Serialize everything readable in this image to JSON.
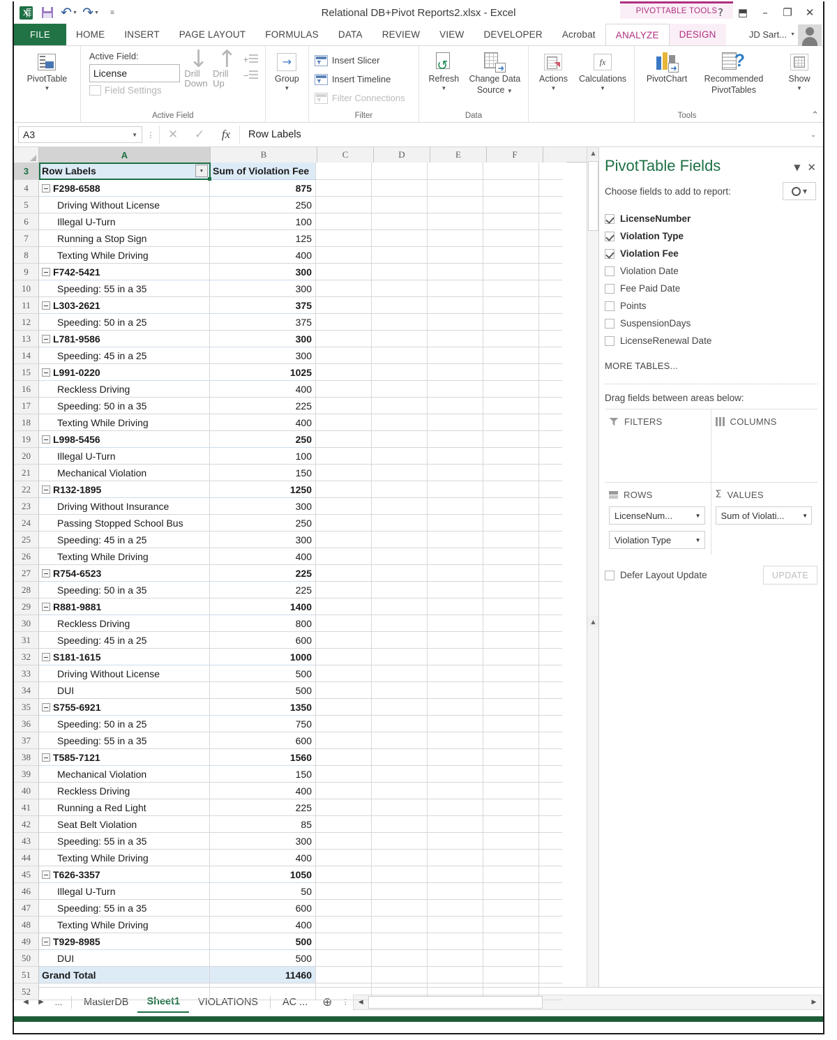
{
  "titlebar": {
    "document_title": "Relational DB+Pivot Reports2.xlsx - Excel",
    "contextual_tools_label": "PIVOTTABLE TOOLS",
    "quick_access": [
      "excel-logo",
      "save-icon",
      "undo-icon",
      "redo-icon",
      "customize-icon"
    ],
    "help_glyph": "?",
    "ribbon_display_glyph": "⬒",
    "minimize_glyph": "–",
    "restore_glyph": "❐",
    "close_glyph": "✕"
  },
  "ribbon_tabs": {
    "file": "FILE",
    "standard": [
      "HOME",
      "INSERT",
      "PAGE LAYOUT",
      "FORMULAS",
      "DATA",
      "REVIEW",
      "VIEW",
      "DEVELOPER",
      "Acrobat"
    ],
    "contextual": [
      "ANALYZE",
      "DESIGN"
    ],
    "active": "ANALYZE",
    "user": "JD Sart..."
  },
  "ribbon": {
    "groups": [
      {
        "label": "",
        "pivottable_button": "PivotTable"
      },
      {
        "label": "Active Field",
        "active_field_label": "Active Field:",
        "active_field_value": "License",
        "field_settings": "Field Settings",
        "drill_down": "Drill Down",
        "drill_up": "Drill Up",
        "expand_field": "+",
        "collapse_field": "−"
      },
      {
        "label": "",
        "group_button": "Group"
      },
      {
        "label": "Filter",
        "items": [
          "Insert Slicer",
          "Insert Timeline",
          "Filter Connections"
        ]
      },
      {
        "label": "Data",
        "refresh": "Refresh",
        "change_data_source_line1": "Change Data",
        "change_data_source_line2": "Source"
      },
      {
        "label": "",
        "actions": "Actions",
        "calculations": "Calculations"
      },
      {
        "label": "Tools",
        "pivotchart": "PivotChart",
        "recommended_line1": "Recommended",
        "recommended_line2": "PivotTables",
        "show": "Show"
      }
    ],
    "collapse_glyph": "⌃"
  },
  "formula_bar": {
    "name_box": "A3",
    "cancel_glyph": "✕",
    "enter_glyph": "✓",
    "fx_glyph": "fx",
    "content": "Row Labels",
    "expand_glyph": "⌄"
  },
  "grid": {
    "column_headers": [
      "A",
      "B",
      "C",
      "D",
      "E",
      "F"
    ],
    "selected_column": "A",
    "selected_row": "3",
    "header_row": {
      "num": "3",
      "label_a": "Row Labels",
      "label_b": "Sum of Violation Fee",
      "filter_glyph": "▼"
    },
    "rows": [
      {
        "num": "4",
        "type": "group",
        "label": "F298-6588",
        "value": "875"
      },
      {
        "num": "5",
        "type": "item",
        "label": "Driving Without License",
        "value": "250"
      },
      {
        "num": "6",
        "type": "item",
        "label": "Illegal U-Turn",
        "value": "100"
      },
      {
        "num": "7",
        "type": "item",
        "label": "Running a Stop Sign",
        "value": "125"
      },
      {
        "num": "8",
        "type": "item",
        "label": "Texting While Driving",
        "value": "400"
      },
      {
        "num": "9",
        "type": "group",
        "label": "F742-5421",
        "value": "300"
      },
      {
        "num": "10",
        "type": "item",
        "label": "Speeding: 55 in a 35",
        "value": "300"
      },
      {
        "num": "11",
        "type": "group",
        "label": "L303-2621",
        "value": "375"
      },
      {
        "num": "12",
        "type": "item",
        "label": "Speeding: 50 in a 25",
        "value": "375"
      },
      {
        "num": "13",
        "type": "group",
        "label": "L781-9586",
        "value": "300"
      },
      {
        "num": "14",
        "type": "item",
        "label": "Speeding: 45 in a 25",
        "value": "300"
      },
      {
        "num": "15",
        "type": "group",
        "label": "L991-0220",
        "value": "1025"
      },
      {
        "num": "16",
        "type": "item",
        "label": "Reckless Driving",
        "value": "400"
      },
      {
        "num": "17",
        "type": "item",
        "label": "Speeding: 50 in a 35",
        "value": "225"
      },
      {
        "num": "18",
        "type": "item",
        "label": "Texting While Driving",
        "value": "400"
      },
      {
        "num": "19",
        "type": "group",
        "label": "L998-5456",
        "value": "250"
      },
      {
        "num": "20",
        "type": "item",
        "label": "Illegal U-Turn",
        "value": "100"
      },
      {
        "num": "21",
        "type": "item",
        "label": "Mechanical Violation",
        "value": "150"
      },
      {
        "num": "22",
        "type": "group",
        "label": "R132-1895",
        "value": "1250"
      },
      {
        "num": "23",
        "type": "item",
        "label": "Driving Without Insurance",
        "value": "300"
      },
      {
        "num": "24",
        "type": "item",
        "label": "Passing Stopped School Bus",
        "value": "250"
      },
      {
        "num": "25",
        "type": "item",
        "label": "Speeding: 45 in a 25",
        "value": "300"
      },
      {
        "num": "26",
        "type": "item",
        "label": "Texting While Driving",
        "value": "400"
      },
      {
        "num": "27",
        "type": "group",
        "label": "R754-6523",
        "value": "225"
      },
      {
        "num": "28",
        "type": "item",
        "label": "Speeding: 50 in a 35",
        "value": "225"
      },
      {
        "num": "29",
        "type": "group",
        "label": "R881-9881",
        "value": "1400"
      },
      {
        "num": "30",
        "type": "item",
        "label": "Reckless Driving",
        "value": "800"
      },
      {
        "num": "31",
        "type": "item",
        "label": "Speeding: 45 in a 25",
        "value": "600"
      },
      {
        "num": "32",
        "type": "group",
        "label": "S181-1615",
        "value": "1000"
      },
      {
        "num": "33",
        "type": "item",
        "label": "Driving Without License",
        "value": "500"
      },
      {
        "num": "34",
        "type": "item",
        "label": "DUI",
        "value": "500"
      },
      {
        "num": "35",
        "type": "group",
        "label": "S755-6921",
        "value": "1350"
      },
      {
        "num": "36",
        "type": "item",
        "label": "Speeding: 50 in a 25",
        "value": "750"
      },
      {
        "num": "37",
        "type": "item",
        "label": "Speeding: 55 in a 35",
        "value": "600"
      },
      {
        "num": "38",
        "type": "group",
        "label": "T585-7121",
        "value": "1560"
      },
      {
        "num": "39",
        "type": "item",
        "label": "Mechanical Violation",
        "value": "150"
      },
      {
        "num": "40",
        "type": "item",
        "label": "Reckless Driving",
        "value": "400"
      },
      {
        "num": "41",
        "type": "item",
        "label": "Running a Red Light",
        "value": "225"
      },
      {
        "num": "42",
        "type": "item",
        "label": "Seat Belt Violation",
        "value": "85"
      },
      {
        "num": "43",
        "type": "item",
        "label": "Speeding: 55 in a 35",
        "value": "300"
      },
      {
        "num": "44",
        "type": "item",
        "label": "Texting While Driving",
        "value": "400"
      },
      {
        "num": "45",
        "type": "group",
        "label": "T626-3357",
        "value": "1050"
      },
      {
        "num": "46",
        "type": "item",
        "label": "Illegal U-Turn",
        "value": "50"
      },
      {
        "num": "47",
        "type": "item",
        "label": "Speeding: 55 in a 35",
        "value": "600"
      },
      {
        "num": "48",
        "type": "item",
        "label": "Texting While Driving",
        "value": "400"
      },
      {
        "num": "49",
        "type": "group",
        "label": "T929-8985",
        "value": "500"
      },
      {
        "num": "50",
        "type": "item",
        "label": "DUI",
        "value": "500"
      },
      {
        "num": "51",
        "type": "total",
        "label": "Grand Total",
        "value": "11460"
      },
      {
        "num": "52",
        "type": "empty",
        "label": "",
        "value": ""
      }
    ],
    "collapse_glyph": "−"
  },
  "pane": {
    "title": "PivotTable Fields",
    "collapse_glyph": "▼",
    "close_glyph": "✕",
    "choose_label": "Choose fields to add to report:",
    "gear_caret": "▾",
    "fields": [
      {
        "label": "LicenseNumber",
        "checked": true
      },
      {
        "label": "Violation Type",
        "checked": true
      },
      {
        "label": "Violation Fee",
        "checked": true
      },
      {
        "label": "Violation Date",
        "checked": false
      },
      {
        "label": "Fee Paid Date",
        "checked": false
      },
      {
        "label": "Points",
        "checked": false
      },
      {
        "label": "SuspensionDays",
        "checked": false
      },
      {
        "label": "LicenseRenewal Date",
        "checked": false
      }
    ],
    "more_tables": "MORE TABLES...",
    "drag_label": "Drag fields between areas below:",
    "areas": {
      "filters": {
        "title": "FILTERS",
        "chips": []
      },
      "columns": {
        "title": "COLUMNS",
        "chips": []
      },
      "rows": {
        "title": "ROWS",
        "chips": [
          "LicenseNum...",
          "Violation Type"
        ]
      },
      "values": {
        "title": "VALUES",
        "chips": [
          "Sum of Violati..."
        ]
      }
    },
    "defer_label": "Defer Layout Update",
    "update_button": "UPDATE"
  },
  "sheet_tabs": {
    "first_glyph": "◀",
    "last_glyph": "▶",
    "overflow_glyph": "...",
    "tabs": [
      "MasterDB",
      "Sheet1",
      "VIOLATIONS",
      "AC ..."
    ],
    "active": "Sheet1",
    "add_glyph": "⊕",
    "menu_glyph": "⋮",
    "hscroll_left": "◀",
    "hscroll_right": "▶"
  },
  "colors": {
    "excel_green": "#217346",
    "pivot_pink": "#b02f7f",
    "header_fill": "#ddebf7",
    "selection_green": "#1d7044"
  }
}
